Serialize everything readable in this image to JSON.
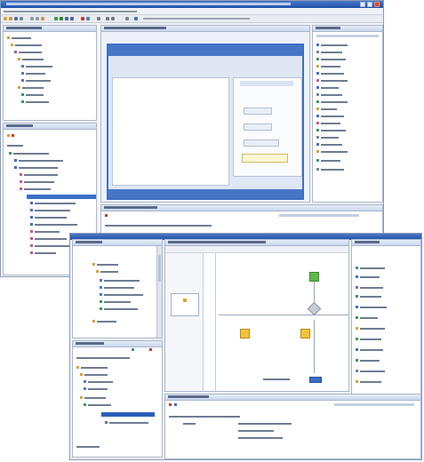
{
  "window_top": {
    "title": "",
    "controls": [
      "minimize-icon",
      "maximize-icon",
      "close-icon"
    ]
  },
  "window_bottom": {
    "title": ""
  },
  "colors": {
    "titlebar": "#2151a8",
    "selection": "#3b6fc7",
    "panel_header": "#c9d7ee",
    "node_green": "#5cb84a",
    "node_yellow": "#f0c43a",
    "node_gray": "#c8ccd3"
  }
}
